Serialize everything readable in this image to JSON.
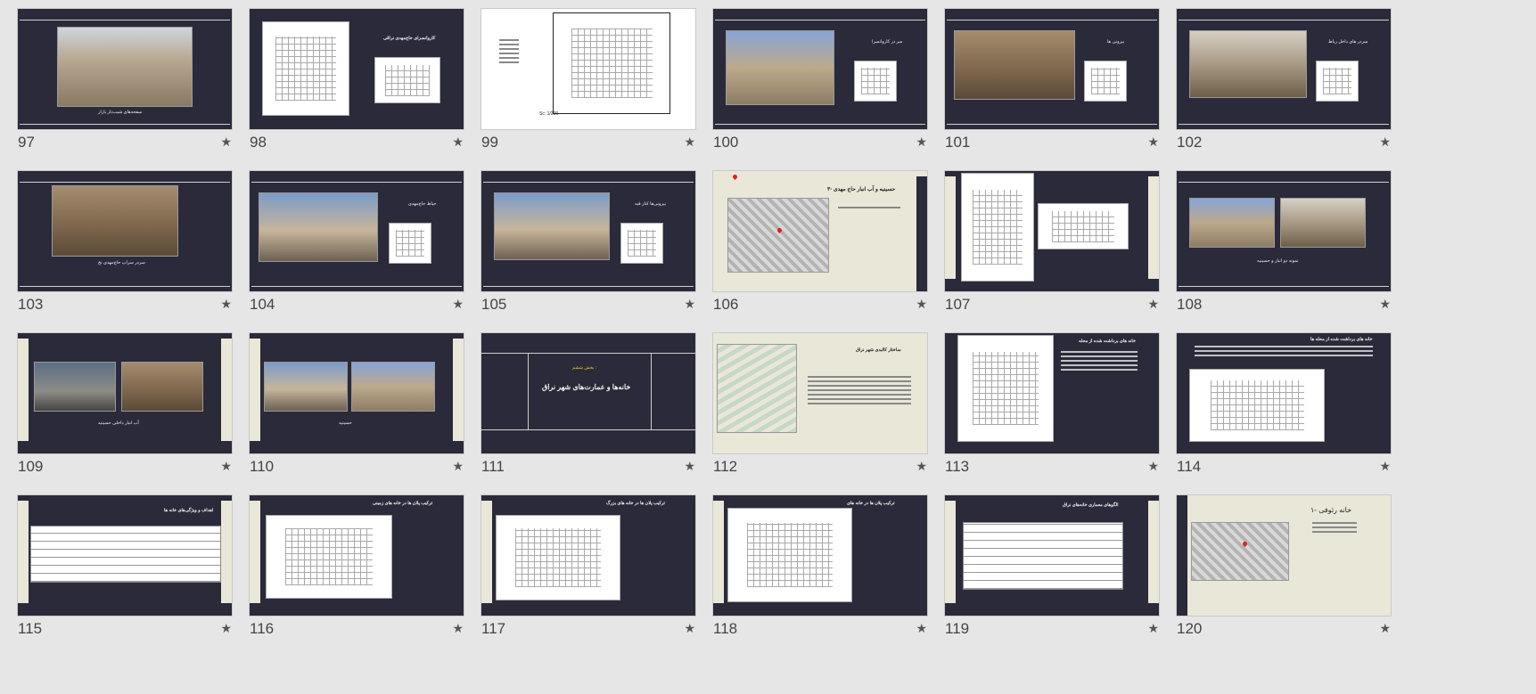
{
  "slides": [
    {
      "number": "97",
      "caption": "سفحه‌های شیب‌دار بازار"
    },
    {
      "number": "98",
      "title": "کاروانسرای حاج‌مهدی نراقی"
    },
    {
      "number": "99",
      "scale": "Sc: 1/200"
    },
    {
      "number": "100",
      "title": "سر در کاروانسرا"
    },
    {
      "number": "101",
      "title": "بیرونی ها"
    },
    {
      "number": "102",
      "title": "سردر های داخل رباط"
    },
    {
      "number": "103",
      "caption": "سردر سراپ حاج‌مهدی نخ"
    },
    {
      "number": "104",
      "title": "حیاط حاج‌مهدی"
    },
    {
      "number": "105",
      "title": "بیرونی‌ها کنار قیه"
    },
    {
      "number": "106",
      "title": "۳- حسینیه و آب انبار حاج مهدی"
    },
    {
      "number": "107"
    },
    {
      "number": "108",
      "caption": "نمونه دو انبار و حسینیه"
    },
    {
      "number": "109",
      "caption": "آب انبار داخلی حسینیه"
    },
    {
      "number": "110",
      "caption": "حسینیه"
    },
    {
      "number": "111",
      "subtitle": "بخش ششم :",
      "title": "خانه‌ها و عمارت‌های شهر نراق"
    },
    {
      "number": "112",
      "title": "ساختار کالبدی شهر نراق"
    },
    {
      "number": "113",
      "title": "خانه های برداشت شده از محله"
    },
    {
      "number": "114",
      "title": "خانه های برداشت شده از محله ها"
    },
    {
      "number": "115",
      "title": "اهداف و ویژگی‌های خانه ها"
    },
    {
      "number": "116",
      "title": "ترکیب پلان ها در خانه های زمینی"
    },
    {
      "number": "117",
      "title": "ترکیب پلان ها در خانه های بزرگ"
    },
    {
      "number": "118",
      "title": "ترکیب پلان ها در خانه های"
    },
    {
      "number": "119",
      "title": "الگوهای معماری خانه‌های نراق"
    },
    {
      "number": "120",
      "title": "۱- خانه رئوفی"
    }
  ],
  "star_icon": "★"
}
